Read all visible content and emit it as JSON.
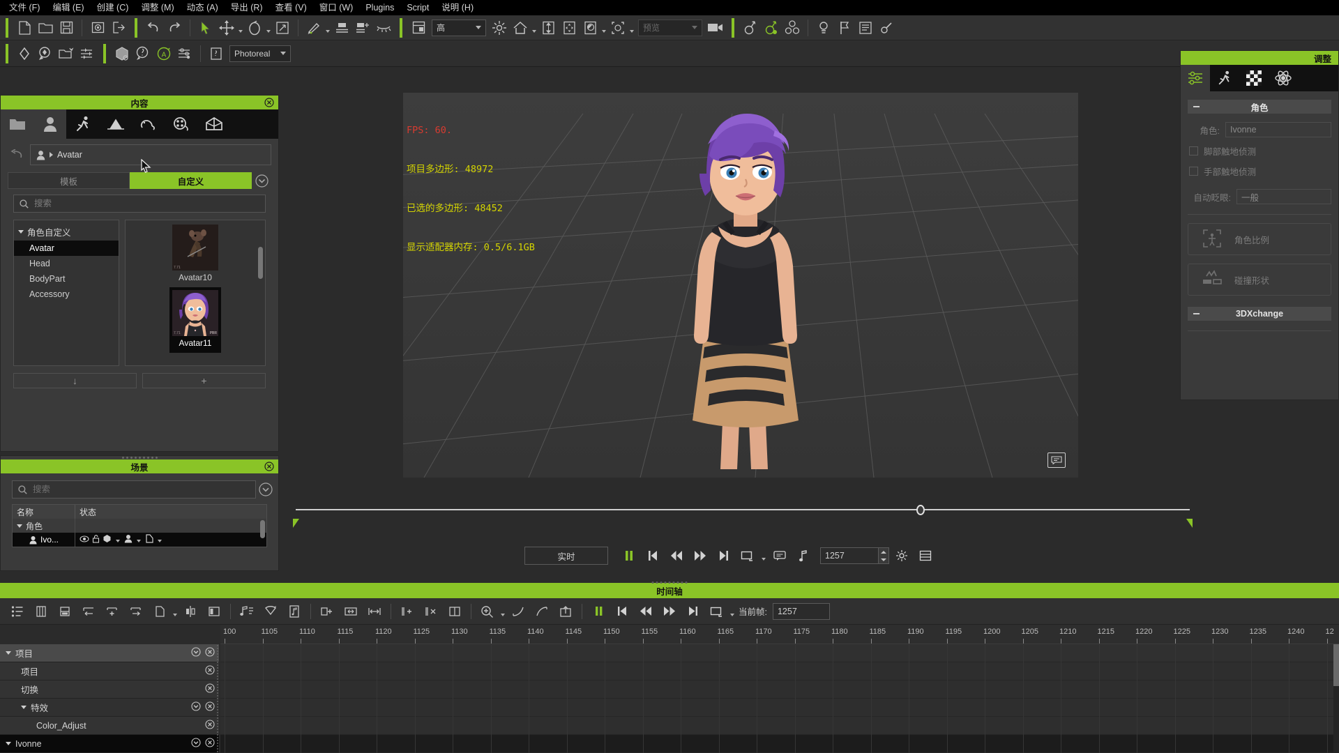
{
  "app": {
    "menu": [
      {
        "label": "文件 (F)",
        "name": "menu-file"
      },
      {
        "label": "编辑 (E)",
        "name": "menu-edit"
      },
      {
        "label": "创建 (C)",
        "name": "menu-create"
      },
      {
        "label": "调整 (M)",
        "name": "menu-modify"
      },
      {
        "label": "动态 (A)",
        "name": "menu-animation"
      },
      {
        "label": "导出 (R)",
        "name": "menu-render"
      },
      {
        "label": "查看 (V)",
        "name": "menu-view"
      },
      {
        "label": "窗口 (W)",
        "name": "menu-window"
      },
      {
        "label": "Plugins",
        "name": "menu-plugins"
      },
      {
        "label": "Script",
        "name": "menu-script"
      },
      {
        "label": "说明 (H)",
        "name": "menu-help"
      }
    ]
  },
  "toolbar_main": {
    "quality_select": "高",
    "preview_select": "预览"
  },
  "toolbar_second": {
    "render_mode": "Photoreal"
  },
  "viewport": {
    "stats": {
      "fps_label": "FPS: 60.",
      "line2": "项目多边形: 48972",
      "line3": "已选的多边形: 48452",
      "line4": "显示适配器内存: 0.5/6.1GB"
    }
  },
  "content_panel": {
    "title": "内容",
    "tabs": [
      {
        "name": "tab-folder",
        "icon": "folder-icon"
      },
      {
        "name": "tab-avatar",
        "icon": "person-icon"
      },
      {
        "name": "tab-motion",
        "icon": "motion-icon"
      },
      {
        "name": "tab-stage",
        "icon": "stage-icon"
      },
      {
        "name": "tab-prop",
        "icon": "prop-icon"
      },
      {
        "name": "tab-media",
        "icon": "film-icon"
      },
      {
        "name": "tab-package",
        "icon": "package-icon"
      }
    ],
    "breadcrumb": "Avatar",
    "mode_tabs": [
      {
        "label": "模板",
        "name": "tab-template",
        "active": false
      },
      {
        "label": "自定义",
        "name": "tab-custom",
        "active": true
      }
    ],
    "search_placeholder": "搜索",
    "search_value": "",
    "tree": {
      "root": "角色自定义",
      "items": [
        {
          "label": "Avatar",
          "selected": true
        },
        {
          "label": "Head",
          "selected": false
        },
        {
          "label": "BodyPart",
          "selected": false
        },
        {
          "label": "Accessory",
          "selected": false
        }
      ]
    },
    "thumbnails": [
      {
        "label": "Avatar10",
        "selected": false,
        "badge_left": "7.71",
        "badge_right": ""
      },
      {
        "label": "Avatar11",
        "selected": true,
        "badge_left": "7.71",
        "badge_right": "PBR"
      }
    ],
    "footer_buttons": [
      {
        "name": "download-button",
        "glyph": "↓"
      },
      {
        "name": "add-button",
        "glyph": "+"
      }
    ]
  },
  "scene_panel": {
    "title": "场景",
    "search_placeholder": "搜索",
    "search_value": "",
    "columns": [
      "名称",
      "状态"
    ],
    "rows": [
      {
        "label": "角色",
        "type": "group",
        "selected": false
      },
      {
        "label": "Ivo...",
        "type": "item",
        "selected": true
      }
    ]
  },
  "right_panel": {
    "title": "调整",
    "tabs": [
      {
        "name": "tab-attribute",
        "icon": "sliders-icon",
        "active": true
      },
      {
        "name": "tab-motion",
        "icon": "motion-icon",
        "active": false
      },
      {
        "name": "tab-material",
        "icon": "checker-icon",
        "active": false
      },
      {
        "name": "tab-physics",
        "icon": "atom-icon",
        "active": false
      }
    ],
    "section_character": "角色",
    "character_label": "角色:",
    "character_value": "Ivonne",
    "checkboxes": [
      {
        "label": "脚部触地侦测",
        "checked": false
      },
      {
        "label": "手部触地侦测",
        "checked": false
      }
    ],
    "blink_label": "自动眨眼:",
    "blink_value": "一般",
    "buttons": [
      {
        "label": "角色比例",
        "name": "character-scale-button",
        "icon": "scale-icon"
      },
      {
        "label": "碰撞形状",
        "name": "collision-shape-button",
        "icon": "collision-icon"
      }
    ],
    "section_3dxchange": "3DXchange"
  },
  "transport": {
    "realtime_label": "实时",
    "frame_value": "1257",
    "buttons": [
      {
        "name": "pause-button",
        "icon": "pause-icon"
      },
      {
        "name": "goto-start-button",
        "icon": "skip-start-icon"
      },
      {
        "name": "rewind-button",
        "icon": "rewind-icon"
      },
      {
        "name": "forward-button",
        "icon": "forward-icon"
      },
      {
        "name": "goto-end-button",
        "icon": "skip-end-icon"
      },
      {
        "name": "loop-range-button",
        "icon": "range-icon"
      },
      {
        "name": "comment-button",
        "icon": "speech-icon"
      },
      {
        "name": "audio-button",
        "icon": "note-icon"
      }
    ]
  },
  "timeline": {
    "title": "时间轴",
    "current_frame_label": "当前帧:",
    "current_frame_value": "1257",
    "ruler_start": 1100,
    "ruler_step": 5,
    "ruler_ticks": [
      "100",
      "1105",
      "1110",
      "1115",
      "1120",
      "1125",
      "1130",
      "1135",
      "1140",
      "1145",
      "1150",
      "1155",
      "1160",
      "1165",
      "1170",
      "1175",
      "1180",
      "1185",
      "1190",
      "1195",
      "1200",
      "1205",
      "1210",
      "1215",
      "1220",
      "1225",
      "1230",
      "1235",
      "1240",
      "12"
    ],
    "tracks": [
      {
        "label": "项目",
        "level": 0,
        "collapse": true,
        "has_chevron": true,
        "has_close": true,
        "style": "grp"
      },
      {
        "label": "项目",
        "level": 1,
        "collapse": false,
        "has_chevron": false,
        "has_close": true,
        "style": "sub"
      },
      {
        "label": "切换",
        "level": 1,
        "collapse": false,
        "has_chevron": false,
        "has_close": true,
        "style": "sub"
      },
      {
        "label": "特效",
        "level": 1,
        "collapse": true,
        "has_chevron": true,
        "has_close": true,
        "style": "sub2"
      },
      {
        "label": "Color_Adjust",
        "level": 2,
        "collapse": false,
        "has_chevron": false,
        "has_close": true,
        "style": "sub"
      },
      {
        "label": "Ivonne",
        "level": 0,
        "collapse": true,
        "has_chevron": true,
        "has_close": true,
        "style": "selrow"
      }
    ]
  },
  "colors": {
    "accent": "#8ac427",
    "panel_bg": "#3a3a3a",
    "dark_bg": "#2b2b2b",
    "stats_red": "#d93b30",
    "stats_yellow": "#d4d400"
  }
}
